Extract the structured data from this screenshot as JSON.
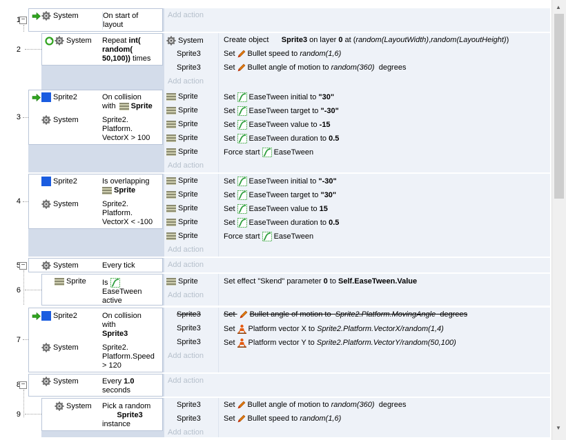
{
  "add_action": "Add action",
  "events": [
    {
      "number": "1",
      "collapsible": true,
      "conditions": [
        {
          "object": "System",
          "icon": "gear-icon",
          "trigger": true,
          "text": "On start of layout"
        }
      ]
    },
    {
      "number": "2",
      "conditions": [
        {
          "object": "System",
          "icon": "gear-icon",
          "text_parts": [
            "Repeat ",
            "int(",
            "random(",
            "50,100)) times"
          ]
        }
      ],
      "actions": [
        {
          "object": "System",
          "text": "Create object   Sprite3 on layer 0 at (random(LayoutWidth), random(LayoutHeight))"
        },
        {
          "object": "Sprite3",
          "text": "Set Bullet speed to random(1,6)"
        },
        {
          "object": "Sprite3",
          "text": "Set Bullet angle of motion to random(360) degrees"
        }
      ]
    },
    {
      "number": "3",
      "conditions": [
        {
          "object": "Sprite2",
          "icon": "blue-square-icon",
          "trigger": true,
          "text": "On collision with Sprite"
        },
        {
          "object": "System",
          "icon": "gear-icon",
          "text": "Sprite2. Platform. VectorX > 100"
        }
      ],
      "actions": [
        {
          "object": "Sprite",
          "text": "Set EaseTween initial to \"30\""
        },
        {
          "object": "Sprite",
          "text": "Set EaseTween target to \"-30\""
        },
        {
          "object": "Sprite",
          "text": "Set EaseTween value to -15"
        },
        {
          "object": "Sprite",
          "text": "Set EaseTween duration to 0.5"
        },
        {
          "object": "Sprite",
          "text": "Force start EaseTween"
        }
      ]
    },
    {
      "number": "4",
      "conditions": [
        {
          "object": "Sprite2",
          "icon": "blue-square-icon",
          "text": "Is overlapping Sprite"
        },
        {
          "object": "System",
          "icon": "gear-icon",
          "text": "Sprite2. Platform. VectorX < -100"
        }
      ],
      "actions": [
        {
          "object": "Sprite",
          "text": "Set EaseTween initial to \"-30\""
        },
        {
          "object": "Sprite",
          "text": "Set EaseTween target to \"30\""
        },
        {
          "object": "Sprite",
          "text": "Set EaseTween value to 15"
        },
        {
          "object": "Sprite",
          "text": "Set EaseTween duration to 0.5"
        },
        {
          "object": "Sprite",
          "text": "Force start EaseTween"
        }
      ]
    },
    {
      "number": "5",
      "collapsible": true,
      "conditions": [
        {
          "object": "System",
          "icon": "gear-icon",
          "text": "Every tick"
        }
      ]
    },
    {
      "number": "6",
      "conditions": [
        {
          "object": "Sprite",
          "icon": "sprite-icon",
          "text": "Is EaseTween active"
        }
      ],
      "actions": [
        {
          "object": "Sprite",
          "text": "Set effect \"Skend\" parameter 0 to Self.EaseTween.Value"
        }
      ]
    },
    {
      "number": "7",
      "conditions": [
        {
          "object": "Sprite2",
          "icon": "blue-square-icon",
          "trigger": true,
          "text": "On collision with Sprite3"
        },
        {
          "object": "System",
          "icon": "gear-icon",
          "text": "Sprite2. Platform.Speed > 120"
        }
      ],
      "actions": [
        {
          "object": "Sprite3",
          "disabled": true,
          "text": "Set Bullet angle of motion to Sprite2.Platform.MovingAngle degrees"
        },
        {
          "object": "Sprite3",
          "text": "Set Platform vector X to Sprite2.Platform.VectorX/random(1,4)"
        },
        {
          "object": "Sprite3",
          "text": "Set Platform vector Y to Sprite2.Platform.VectorY/random(50,100)"
        }
      ]
    },
    {
      "number": "8",
      "collapsible": true,
      "conditions": [
        {
          "object": "System",
          "icon": "gear-icon",
          "text": "Every 1.0 seconds"
        }
      ]
    },
    {
      "number": "9",
      "conditions": [
        {
          "object": "System",
          "icon": "gear-icon",
          "text": "Pick a random Sprite3 instance"
        }
      ],
      "actions": [
        {
          "object": "Sprite3",
          "text": "Set Bullet angle of motion to random(360) degrees"
        },
        {
          "object": "Sprite3",
          "text": "Set Bullet speed to random(1,6)"
        }
      ]
    }
  ]
}
